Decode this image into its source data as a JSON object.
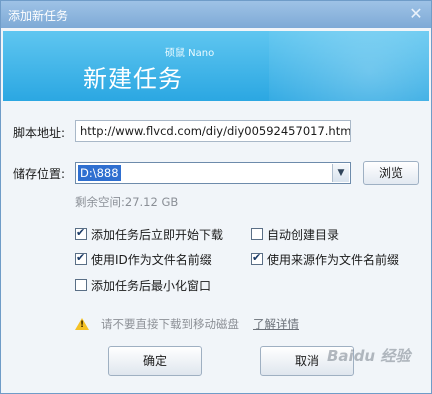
{
  "window": {
    "title": "添加新任务",
    "close_glyph": "✕"
  },
  "banner": {
    "brand": "硕鼠 Nano",
    "headline": "新建任务",
    "accent_color": "#2ba7e2"
  },
  "form": {
    "url_label": "脚本地址:",
    "url_value": "http://www.flvcd.com/diy/diy00592457017.htm",
    "path_label": "储存位置:",
    "path_value": "D:\\888",
    "browse_label": "浏览",
    "free_space": "剩余空间:27.12 GB"
  },
  "options": [
    {
      "label": "添加任务后立即开始下载",
      "checked": true
    },
    {
      "label": "自动创建目录",
      "checked": false
    },
    {
      "label": "使用ID作为文件名前缀",
      "checked": true
    },
    {
      "label": "使用来源作为文件名前缀",
      "checked": true
    },
    {
      "label": "添加任务后最小化窗口",
      "checked": false
    }
  ],
  "warning": {
    "text": "请不要直接下载到移动磁盘",
    "link": "了解详情"
  },
  "buttons": {
    "ok": "确定",
    "cancel": "取消"
  },
  "watermark": "Baidu 经验"
}
